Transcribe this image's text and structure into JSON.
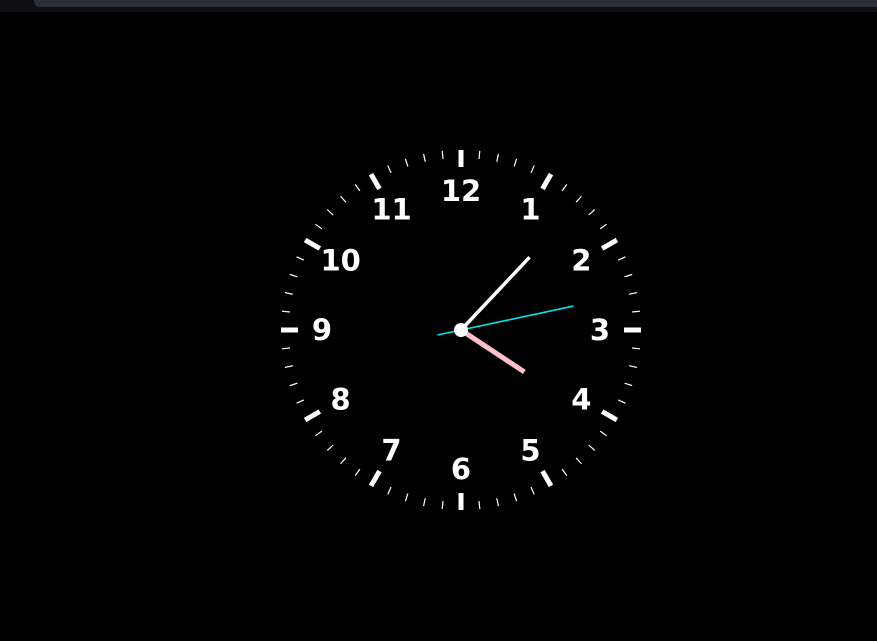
{
  "clock": {
    "numerals": [
      "12",
      "1",
      "2",
      "3",
      "4",
      "5",
      "6",
      "7",
      "8",
      "9",
      "10",
      "11"
    ],
    "time": {
      "hours": 4,
      "minutes": 7,
      "seconds": 13
    },
    "colors": {
      "background": "#000000",
      "face_marks": "#ffffff",
      "hour_hand": "#ffc0cb",
      "minute_hand": "#ffffff",
      "second_hand": "#00e5ee",
      "center_dot": "#ffffff",
      "top_bar": "#2a2e36"
    }
  }
}
